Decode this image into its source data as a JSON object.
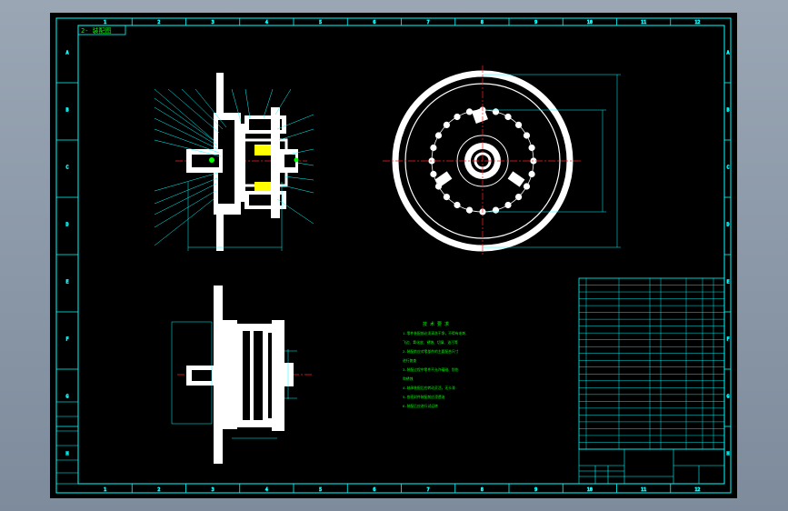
{
  "drawing": {
    "title_tab": "2- 装配图",
    "border_letters": [
      "A",
      "B",
      "C",
      "D",
      "E",
      "F",
      "G",
      "H"
    ],
    "zone_numbers_top": [
      "1",
      "2",
      "3",
      "4",
      "5",
      "6",
      "7",
      "8",
      "9",
      "10",
      "11",
      "12"
    ],
    "zone_numbers_bottom": [
      "1",
      "2",
      "3",
      "4",
      "5",
      "6",
      "7",
      "8",
      "9",
      "10",
      "11",
      "12"
    ],
    "left_stamp_labels": [
      "",
      "",
      "",
      "",
      ""
    ],
    "tech_requirements": {
      "heading": "技 术 要 求",
      "lines": [
        "1.零件装配前必须清洗干净，不得有毛刺、",
        "飞边、氧化皮、锈蚀、切屑、油污等",
        "2.装配前应对零部件的主要配合尺寸",
        "进行复查",
        "3.装配过程中零件不允许磕碰、划伤",
        "和锈蚀",
        "4.轴承装配后应转动灵活，无卡滞",
        "5.各密封件装配前应浸透油",
        "6.装配后应进行试运转"
      ]
    },
    "title_block": {
      "company": "",
      "drawing_name": "",
      "drawing_code": ""
    },
    "bom_rows": 25,
    "colors": {
      "background": "#000000",
      "frame": "#00ffff",
      "geometry": "#ffffff",
      "centerline": "#ff2020",
      "text": "#00ff00",
      "accent": "#ffff00"
    }
  }
}
